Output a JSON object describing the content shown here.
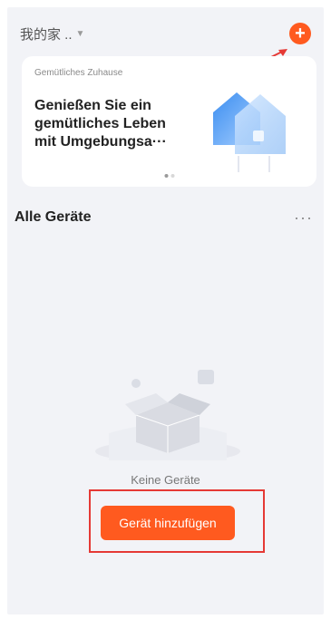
{
  "header": {
    "home_name": "我的家 ..",
    "caret_icon": "caret-down-icon",
    "add_icon": "plus-circle-icon",
    "accent_color": "#ff5a1f"
  },
  "scene_card": {
    "subtitle": "Gemütliches Zuhause",
    "headline": "Genießen Sie ein gemütliches Leben mit Umgebungsa···",
    "illustration_icon": "house-illustration-icon",
    "pagination": {
      "count": 2,
      "active": 0
    }
  },
  "devices": {
    "title": "Alle Geräte",
    "more_icon": "more-horizontal-icon"
  },
  "empty_state": {
    "illustration_icon": "empty-box-icon",
    "message": "Keine Geräte",
    "button_label": "Gerät hinzufügen"
  }
}
